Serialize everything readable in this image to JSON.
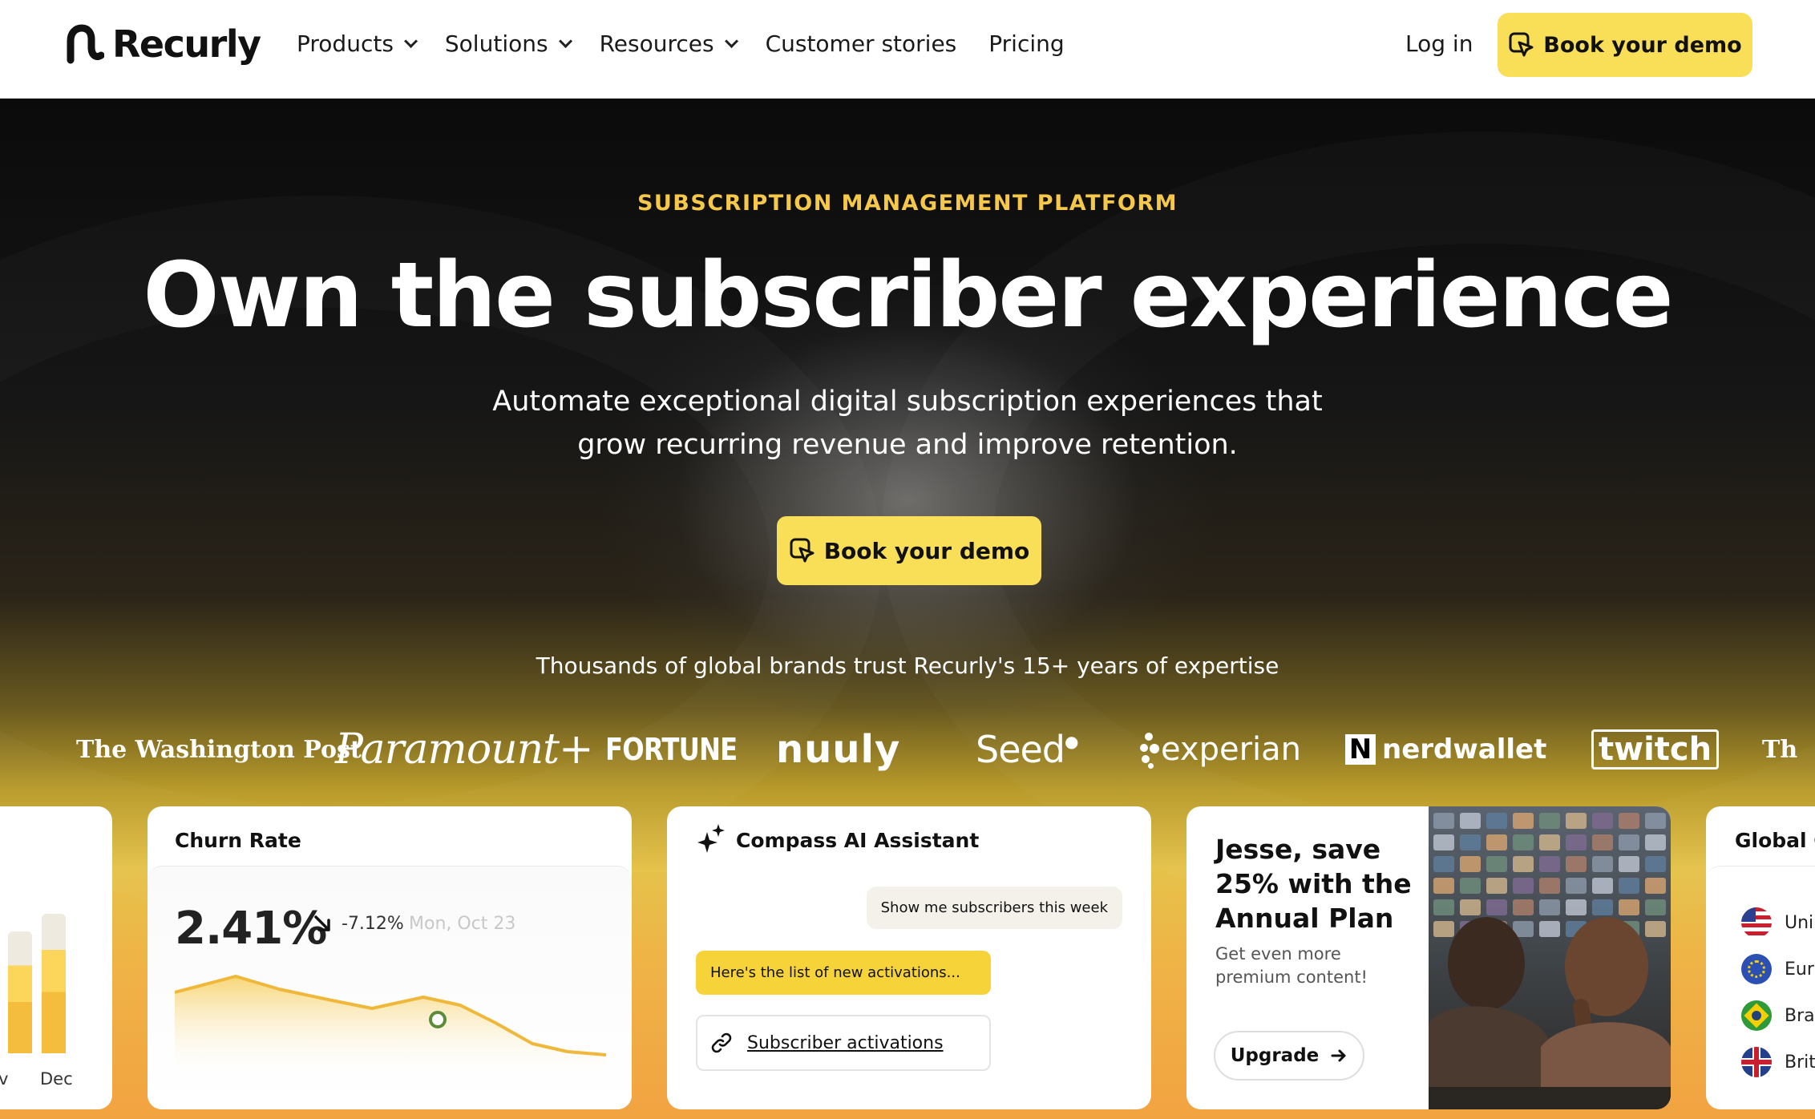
{
  "brand": {
    "name": "Recurly"
  },
  "nav": {
    "items": [
      {
        "label": "Products",
        "dropdown": true
      },
      {
        "label": "Solutions",
        "dropdown": true
      },
      {
        "label": "Resources",
        "dropdown": true
      },
      {
        "label": "Customer stories",
        "dropdown": false
      },
      {
        "label": "Pricing",
        "dropdown": false
      }
    ],
    "login_label": "Log in",
    "cta_label": "Book your demo"
  },
  "hero": {
    "eyebrow": "SUBSCRIPTION MANAGEMENT PLATFORM",
    "headline": "Own the subscriber experience",
    "subline_1": "Automate exceptional digital subscription experiences that",
    "subline_2": "grow recurring revenue and improve retention.",
    "cta_label": "Book your demo",
    "trust_text": "Thousands of global brands trust Recurly's 15+ years of expertise"
  },
  "customer_logos": [
    "The Washington Post",
    "Paramount+",
    "FORTUNE",
    "nuuly",
    "Seed",
    "experian",
    "nerdwallet",
    "twitch",
    "Th"
  ],
  "cards": {
    "partial_bar": {
      "labels": [
        "v",
        "Dec"
      ]
    },
    "churn": {
      "title": "Churn Rate",
      "value": "2.41%",
      "change": "-7.12%",
      "date": "Mon, Oct 23"
    },
    "assistant": {
      "title": "Compass AI Assistant",
      "user_message": "Show me subscribers this week",
      "ai_message": "Here's the list of new activations...",
      "link_label": "Subscriber activations"
    },
    "promo": {
      "title": "Jesse, save 25% with the Annual Plan",
      "subtitle": "Get even more premium content!",
      "button_label": "Upgrade"
    },
    "global": {
      "title": "Global C",
      "rows": [
        "Uni",
        "Eur",
        "Bra",
        "Brit"
      ]
    }
  },
  "colors": {
    "accent": "#f9de58",
    "eyebrow": "#f5c84a",
    "hero_bg": "#0c0c0c"
  },
  "icons": {
    "cta": "cursor-click-icon",
    "assistant": "sparkle-icon",
    "link": "link-icon",
    "upgrade": "arrow-right-icon",
    "trend": "arrow-down-right-icon"
  }
}
